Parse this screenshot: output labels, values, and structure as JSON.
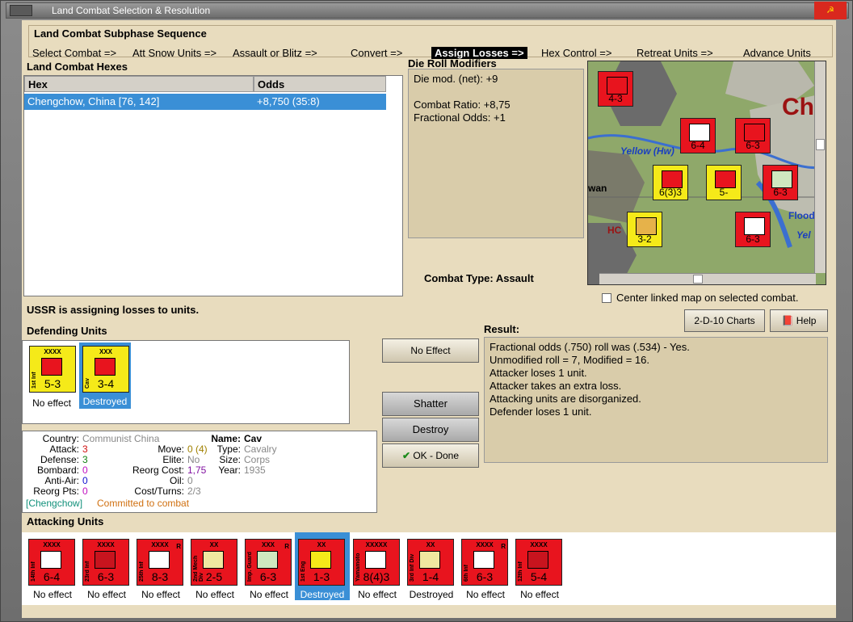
{
  "window": {
    "title": "Land Combat Selection & Resolution"
  },
  "sequence": {
    "title": "Land Combat Subphase Sequence",
    "items": [
      "Select Combat =>",
      "Att Snow Units =>",
      "Assault or Blitz =>",
      "Convert =>",
      "Assign Losses =>",
      "Hex Control =>",
      "Retreat Units =>",
      "Advance Units"
    ]
  },
  "hexes": {
    "title": "Land Combat Hexes",
    "col_hex": "Hex",
    "col_odds": "Odds",
    "row_hex": "Chengchow, China [76, 142]",
    "row_odds": "+8,750 (35:8)"
  },
  "die": {
    "title": "Die Roll Modifiers",
    "l1": "Die mod. (net): +9",
    "l2": "Combat Ratio: +8,75",
    "l3": "Fractional Odds: +1"
  },
  "combat_type": "Combat Type:  Assault",
  "center_label": "Center linked map on selected combat.",
  "buttons": {
    "charts": "2-D-10 Charts",
    "help": "Help",
    "no_effect": "No Effect",
    "shatter": "Shatter",
    "destroy": "Destroy",
    "ok": "OK - Done"
  },
  "status": "USSR is assigning losses to units.",
  "defending": {
    "title": "Defending Units",
    "units": [
      {
        "name": "1st Inf",
        "size": "XXXX",
        "val": "5-3",
        "label": "No effect"
      },
      {
        "name": "Cav",
        "size": "XXX",
        "val": "3-4",
        "label": "Destroyed"
      }
    ]
  },
  "result": {
    "title": "Result:",
    "lines": [
      "Fractional odds (.750) roll was (.534)  - Yes.",
      "Unmodified roll = 7, Modified = 16.",
      "Attacker loses 1 unit.",
      "Attacker takes an extra loss.",
      "Attacking units are disorganized.",
      "Defender loses 1 unit."
    ]
  },
  "info": {
    "country_k": "Country:",
    "country": "Communist China",
    "attack_k": "Attack:",
    "attack": "3",
    "defense_k": "Defense:",
    "defense": "3",
    "bombard_k": "Bombard:",
    "bombard": "0",
    "aa_k": "Anti-Air:",
    "aa": "0",
    "reorgpts_k": "Reorg Pts:",
    "reorgpts": "0",
    "move_k": "Move:",
    "move": "0 (4)",
    "elite_k": "Elite:",
    "elite": "No",
    "reorgcost_k": "Reorg Cost:",
    "reorgcost": "1,75",
    "oil_k": "Oil:",
    "oil": "0",
    "cost_k": "Cost/Turns:",
    "cost": "2/3",
    "name_k": "Name:",
    "name": "Cav",
    "type_k": "Type:",
    "type": "Cavalry",
    "size_k": "Size:",
    "size": "Corps",
    "year_k": "Year:",
    "year": "1935",
    "loc": "[Chengchow]",
    "note": "Committed to combat"
  },
  "attacking": {
    "title": "Attacking Units",
    "units": [
      {
        "name": "14th Inf",
        "size": "XXXX",
        "val": "6-4",
        "label": "No effect",
        "r": ""
      },
      {
        "name": "23rd Inf",
        "size": "XXXX",
        "val": "6-3",
        "label": "No effect",
        "r": ""
      },
      {
        "name": "25th Inf",
        "size": "XXXX",
        "val": "8-3",
        "label": "No effect",
        "r": "R"
      },
      {
        "name": "2nd Mech Div",
        "size": "XX",
        "val": "2-5",
        "label": "No effect",
        "r": ""
      },
      {
        "name": "Imp. Guard",
        "size": "XXX",
        "val": "6-3",
        "label": "No effect",
        "r": "R"
      },
      {
        "name": "1st Eng",
        "size": "XX",
        "val": "1-3",
        "label": "Destroyed",
        "r": ""
      },
      {
        "name": "Yamamoto",
        "size": "XXXXX",
        "val": "8(4)3",
        "label": "No effect",
        "r": ""
      },
      {
        "name": "3rd Inf Div",
        "size": "XX",
        "val": "1-4",
        "label": "Destroyed",
        "r": ""
      },
      {
        "name": "6th Inf",
        "size": "XXXX",
        "val": "6-3",
        "label": "No effect",
        "r": "R"
      },
      {
        "name": "12th Inf",
        "size": "XXXX",
        "val": "5-4",
        "label": "No effect",
        "r": ""
      }
    ]
  },
  "map": {
    "labels": [
      "Yellow (Hw)",
      "wan",
      "Flood",
      "Yel",
      "Ch",
      "HC"
    ],
    "units": [
      {
        "val": "4-3"
      },
      {
        "val": "6-4"
      },
      {
        "val": "6-3"
      },
      {
        "val": "6(3)3"
      },
      {
        "val": "5-"
      },
      {
        "val": "6-3"
      },
      {
        "val": "6-3"
      },
      {
        "val": "3-2"
      }
    ]
  },
  "colors": {
    "bg": "#e8dcbe",
    "red": "#e8141e",
    "yellow": "#f5ea19",
    "select": "#3a8fd6"
  }
}
